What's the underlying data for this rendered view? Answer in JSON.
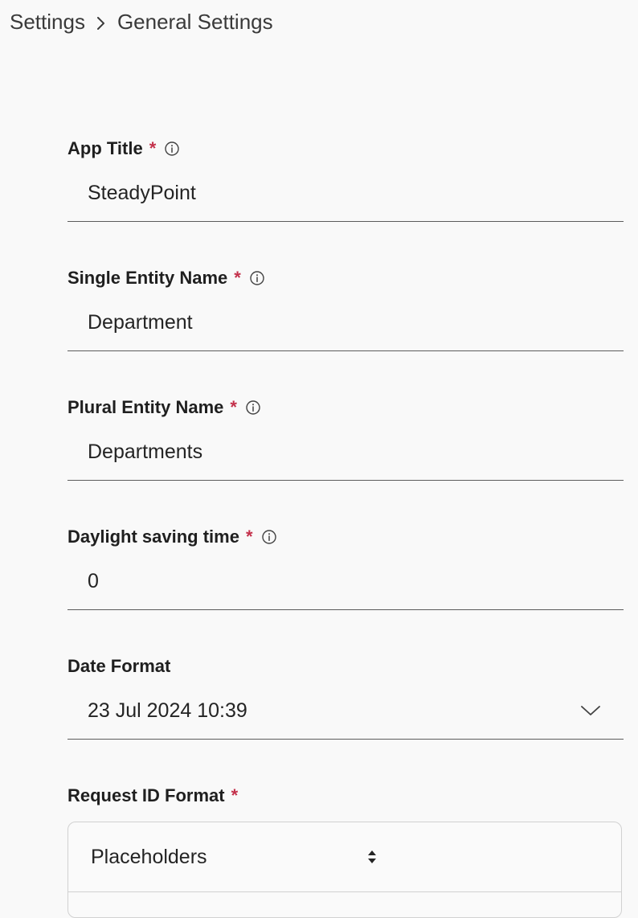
{
  "breadcrumb": {
    "root": "Settings",
    "current": "General Settings"
  },
  "form": {
    "app_title": {
      "label": "App Title",
      "required": "*",
      "value": "SteadyPoint"
    },
    "single_entity_name": {
      "label": "Single Entity Name",
      "required": "*",
      "value": "Department"
    },
    "plural_entity_name": {
      "label": "Plural Entity Name",
      "required": "*",
      "value": "Departments"
    },
    "daylight_saving_time": {
      "label": "Daylight saving time",
      "required": "*",
      "value": "0"
    },
    "date_format": {
      "label": "Date Format",
      "selected": "23 Jul 2024 10:39"
    },
    "request_id_format": {
      "label": "Request ID Format",
      "required": "*",
      "selected": "Placeholders"
    }
  },
  "icons": {
    "breadcrumb_separator": "chevron-right-icon",
    "info": "info-icon",
    "dropdown": "chevron-down-icon",
    "sort": "sort-updown-icon"
  },
  "colors": {
    "required": "#c4314b",
    "underline": "#5c5c5c",
    "background": "#f9f9f9"
  }
}
